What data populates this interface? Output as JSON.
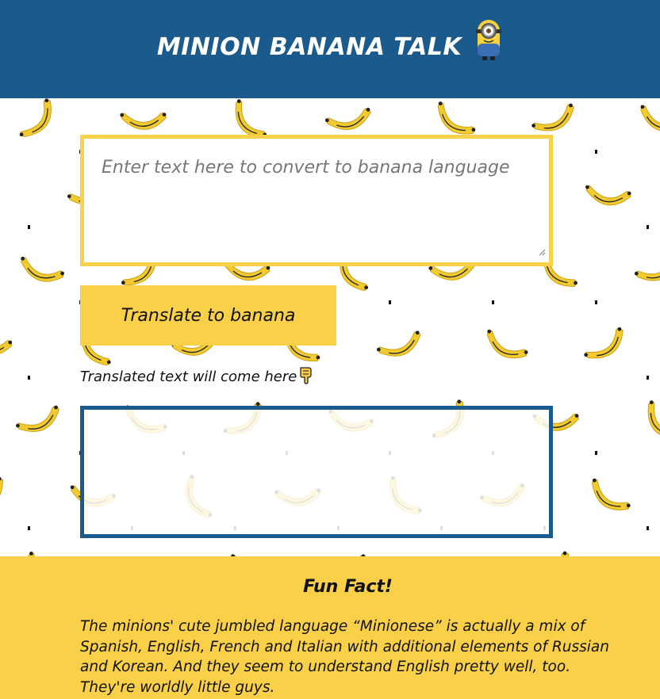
{
  "header": {
    "title": "MINION BANANA TALK",
    "icon": "minion-icon"
  },
  "input": {
    "placeholder": "Enter text here to convert to banana language",
    "value": ""
  },
  "translate_button": {
    "label": "Translate to banana"
  },
  "output": {
    "label": "Translated text will come here",
    "label_icon": "pointing-hand-icon",
    "value": ""
  },
  "fun_fact": {
    "title": "Fun Fact!",
    "body": "The minions' cute jumbled language “Minionese” is actually a mix of Spanish, English, French and Italian with additional elements of Russian and Korean. And they seem to understand English pretty well, too. They're worldly little guys."
  },
  "colors": {
    "header_bg": "#1b5a8c",
    "accent_yellow": "#f9d048",
    "output_border": "#1b5a8c"
  }
}
